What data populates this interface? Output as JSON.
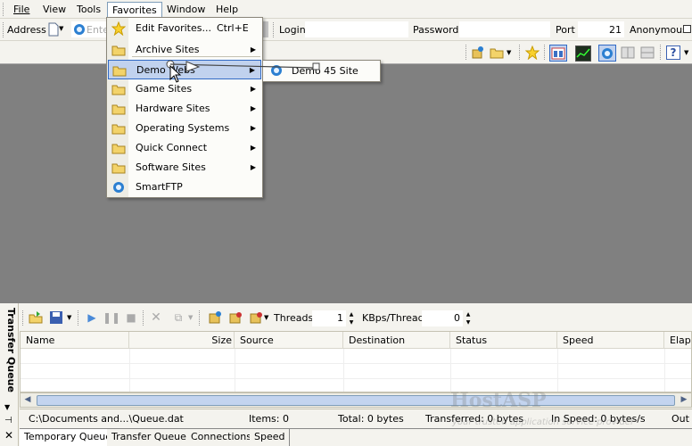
{
  "menubar": {
    "items": [
      {
        "label": "File"
      },
      {
        "label": "View"
      },
      {
        "label": "Tools"
      },
      {
        "label": "Favorites"
      },
      {
        "label": "Window"
      },
      {
        "label": "Help"
      }
    ]
  },
  "toolbar": {
    "address_label": "Address",
    "address_placeholder": "Ente",
    "login_label": "Login",
    "password_label": "Password",
    "port_label": "Port",
    "port_value": "21",
    "anonymous_label": "Anonymous"
  },
  "favorites_menu": {
    "items": [
      {
        "label": "Edit Favorites...",
        "shortcut": "Ctrl+E",
        "icon": "star-icon"
      },
      {
        "label": "Archive Sites",
        "icon": "folder-icon",
        "submenu": true
      },
      {
        "label": "Demo Webs",
        "icon": "folder-icon",
        "submenu": true
      },
      {
        "label": "Game Sites",
        "icon": "folder-icon",
        "submenu": true
      },
      {
        "label": "Hardware Sites",
        "icon": "folder-icon",
        "submenu": true
      },
      {
        "label": "Operating Systems",
        "icon": "folder-icon",
        "submenu": true
      },
      {
        "label": "Quick Connect",
        "icon": "folder-icon",
        "submenu": true
      },
      {
        "label": "Software Sites",
        "icon": "folder-icon",
        "submenu": true
      },
      {
        "label": "SmartFTP",
        "icon": "globe-icon",
        "submenu": false
      }
    ],
    "submenu_item": "Demo 45 Site"
  },
  "transfer_queue": {
    "title": "Transfer Queue",
    "threads_label": "Threads",
    "threads_value": "1",
    "kbps_label": "KBps/Thread",
    "kbps_value": "0",
    "columns": [
      "Name",
      "Size",
      "Source",
      "Destination",
      "Status",
      "Speed",
      "Elaps"
    ]
  },
  "status": {
    "file": "C:\\Documents and...\\Queue.dat",
    "items": "Items: 0",
    "total": "Total: 0 bytes",
    "transferred": "Transferred: 0 bytes",
    "in_speed": "In Speed: 0 bytes/s",
    "out": "Out"
  },
  "tabs": [
    "Temporary Queue",
    "Transfer Queue",
    "Connections",
    "Speed"
  ],
  "watermark": {
    "text": "HostASP",
    "subtext": "your trusted application service provider"
  },
  "colors": {
    "accent": "#316ac5",
    "highlight": "#c1d2ee",
    "workspace": "#808080"
  }
}
